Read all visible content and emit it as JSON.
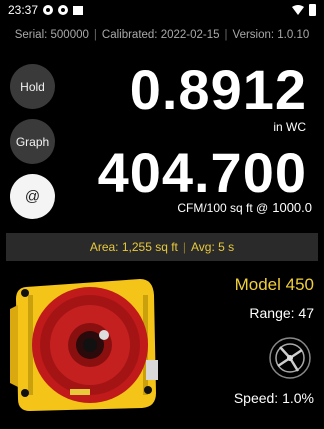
{
  "status_bar": {
    "time": "23:37",
    "icons": [
      "notification-icon",
      "notification-icon",
      "image-icon"
    ],
    "right_icons": [
      "wifi-icon",
      "battery-icon"
    ]
  },
  "info": {
    "serial": "Serial: 500000",
    "calibrated": "Calibrated: 2022-02-15",
    "version": "Version: 1.0.10"
  },
  "buttons": {
    "hold": "Hold",
    "graph": "Graph",
    "at": "@"
  },
  "pressure": {
    "value": "0.8912",
    "unit": "in WC"
  },
  "flow": {
    "value": "404.700",
    "unit": "CFM/100 sq ft @",
    "reference": "1000.0"
  },
  "summary": {
    "area": "Area: 1,255 sq ft",
    "avg": "Avg: 5 s"
  },
  "device": {
    "model": "Model 450",
    "range": "Range: 47",
    "speed": "Speed: 1.0%",
    "colors": {
      "body": "#f4c418",
      "ring": "#c01a1a",
      "accent": "#f0cf3a"
    }
  }
}
